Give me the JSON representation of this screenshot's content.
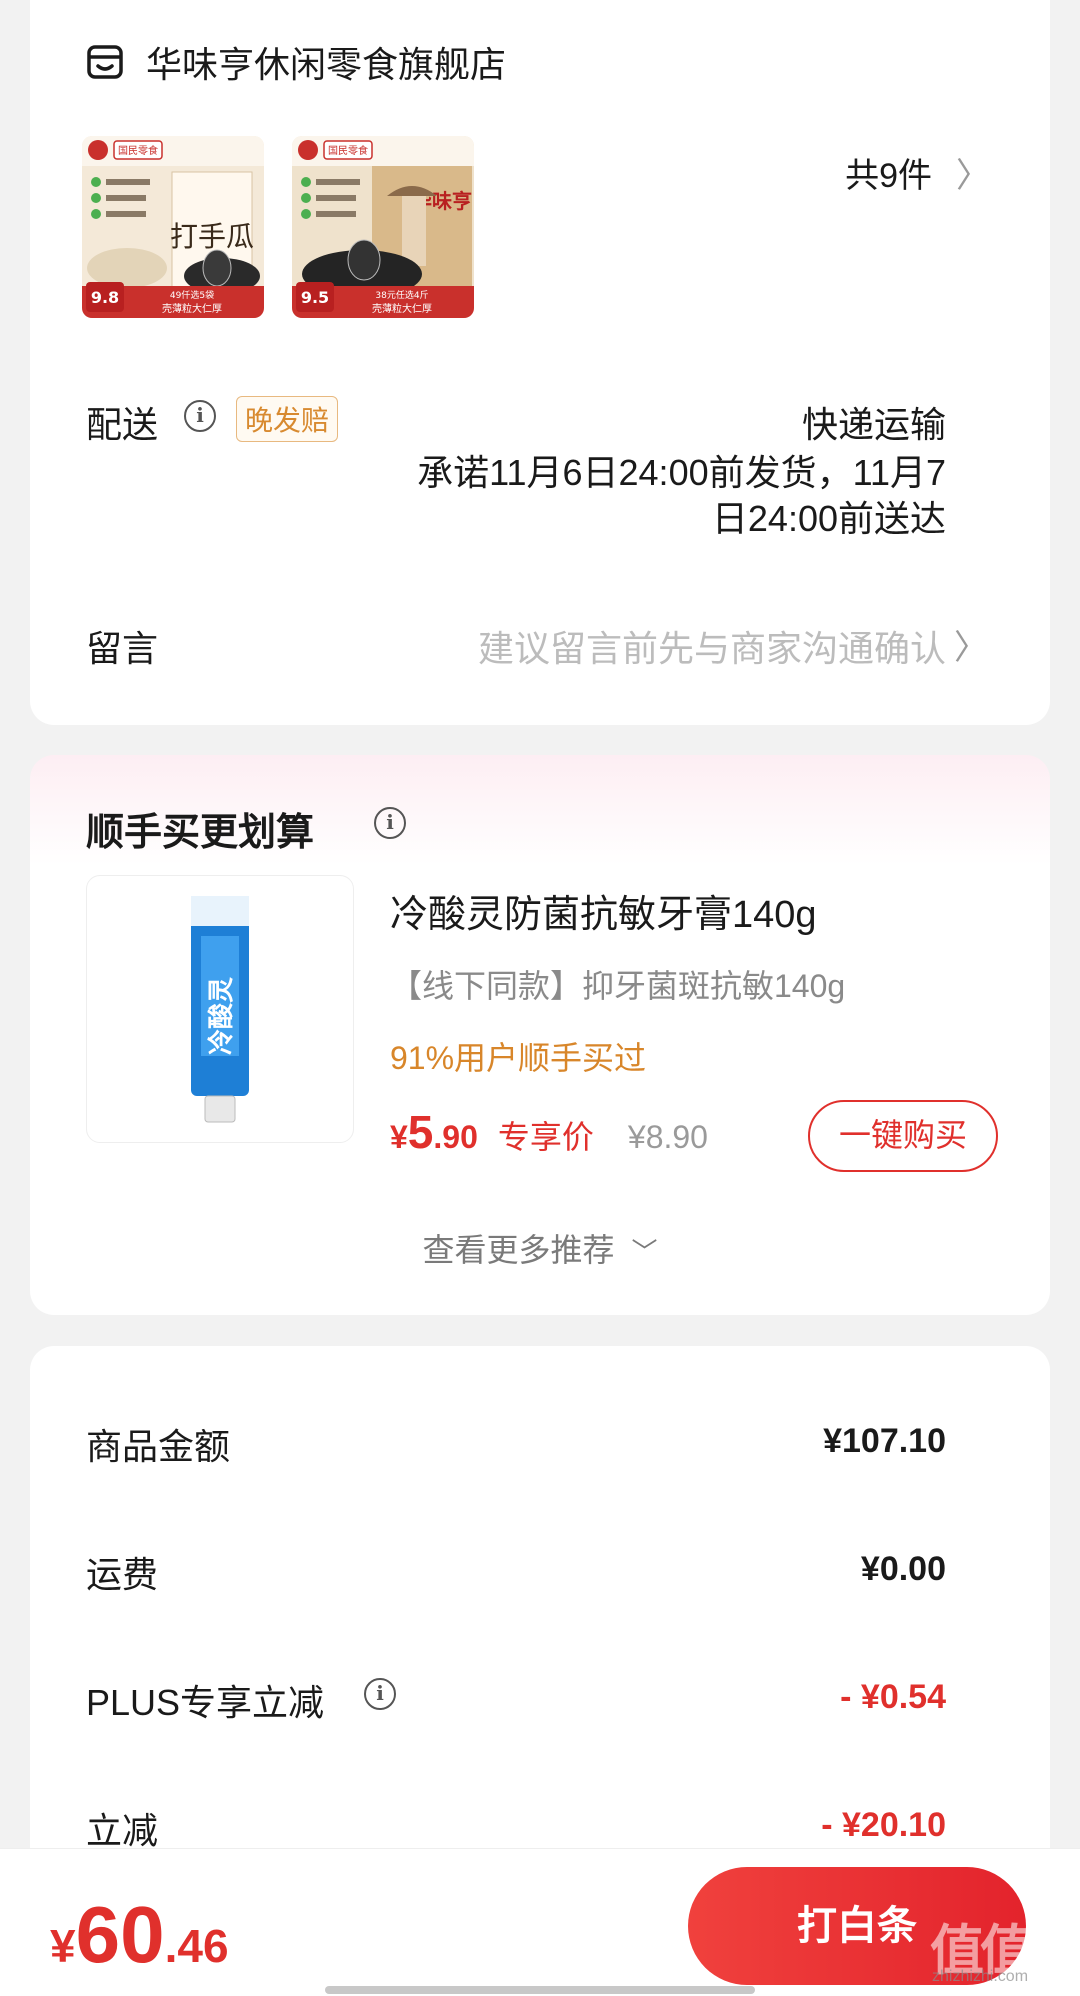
{
  "store": {
    "name": "华味亨休闲零食旗舰店",
    "item_count": "共9件"
  },
  "thumbs": [
    {
      "brand": "国民零食",
      "price": "9.8",
      "promo": "49仟选5袋",
      "tag": "壳薄粒大仁厚",
      "art_text": "打手瓜"
    },
    {
      "brand": "国民零食",
      "price": "9.5",
      "promo": "38元任选4斤",
      "tag": "壳薄粒大仁厚",
      "art_text": "华味亨"
    }
  ],
  "delivery": {
    "label": "配送",
    "badge": "晚发赔",
    "method": "快递运输",
    "promise": "承诺11月6日24:00前发货，11月7日24:00前送达"
  },
  "note": {
    "label": "留言",
    "placeholder": "建议留言前先与商家沟通确认"
  },
  "upsell": {
    "title": "顺手买更划算",
    "product_name": "冷酸灵防菌抗敏牙膏140g",
    "product_desc": "【线下同款】抑牙菌斑抗敏140g",
    "social_proof": "91%用户顺手买过",
    "price_yen": "¥",
    "price_int": "5",
    "price_dec": ".90",
    "price_tag": "专享价",
    "price_orig": "¥8.90",
    "buy_label": "一键购买",
    "more_label": "查看更多推荐",
    "tube_text": "冷酸灵"
  },
  "summary": {
    "rows": [
      {
        "label": "商品金额",
        "value": "¥107.10"
      },
      {
        "label": "运费",
        "value": "¥0.00"
      },
      {
        "label": "PLUS专享立减",
        "value": "- ¥0.54"
      },
      {
        "label": "立减",
        "value": "- ¥20.10"
      }
    ]
  },
  "bottom": {
    "total_yen": "¥",
    "total_int": "60",
    "total_dec": ".46",
    "pay_label": "打白条"
  },
  "watermark": {
    "text": "值值值",
    "sub": "zhizhizhi.com"
  },
  "colors": {
    "accent_red": "#e0302c",
    "social_orange": "#d8862a",
    "badge_orange": "#d88a30"
  }
}
